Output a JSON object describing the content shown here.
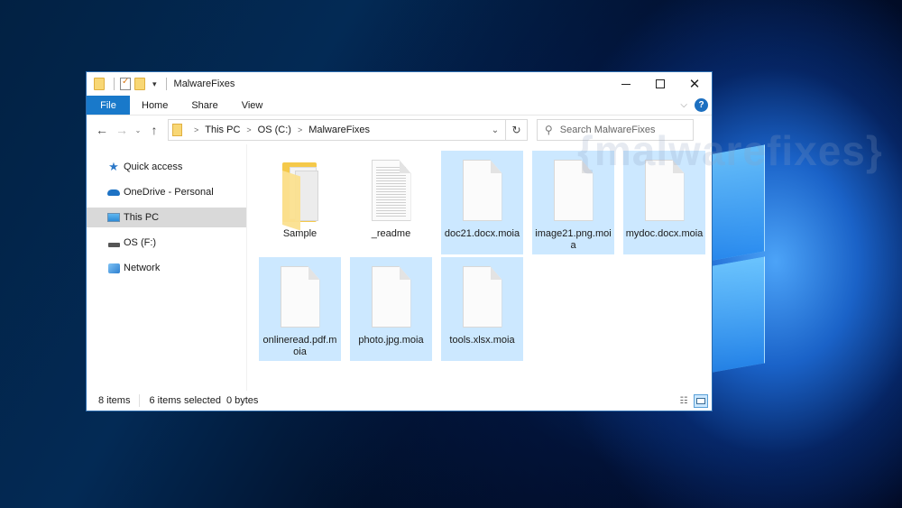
{
  "window": {
    "title": "MalwareFixes",
    "controls": {
      "minimize": "minimize",
      "maximize": "maximize",
      "close": "✕"
    }
  },
  "quick_access_toolbar": {
    "icons": [
      "folder-icon",
      "properties-icon",
      "new-folder-icon"
    ],
    "dropdown": "▾"
  },
  "ribbon": {
    "tabs": [
      {
        "label": "File",
        "active": true
      },
      {
        "label": "Home"
      },
      {
        "label": "Share"
      },
      {
        "label": "View"
      }
    ],
    "expand_chevron": "⌵",
    "help": "?"
  },
  "navigation": {
    "back": "←",
    "forward": "→",
    "recent": "⌄",
    "up": "↑",
    "breadcrumb": [
      "This PC",
      "OS (C:)",
      "MalwareFixes"
    ],
    "breadcrumb_separator": ">",
    "address_dropdown": "⌄",
    "refresh": "↻",
    "search_placeholder": "Search MalwareFixes",
    "search_value": ""
  },
  "sidebar": {
    "items": [
      {
        "label": "Quick access",
        "icon": "star-icon"
      },
      {
        "label": "OneDrive - Personal",
        "icon": "cloud-icon"
      },
      {
        "label": "This PC",
        "icon": "computer-icon",
        "selected": true
      },
      {
        "label": "OS (F:)",
        "icon": "drive-icon"
      },
      {
        "label": "Network",
        "icon": "network-icon"
      }
    ]
  },
  "files": [
    {
      "name": "Sample",
      "type": "folder",
      "selected": false
    },
    {
      "name": "_readme",
      "type": "text",
      "selected": false
    },
    {
      "name": "doc21.docx.moia",
      "type": "blank",
      "selected": true
    },
    {
      "name": "image21.png.moia",
      "type": "blank",
      "selected": true
    },
    {
      "name": "mydoc.docx.moia",
      "type": "blank",
      "selected": true
    },
    {
      "name": "onlineread.pdf.moia",
      "type": "blank",
      "selected": true
    },
    {
      "name": "photo.jpg.moia",
      "type": "blank",
      "selected": true
    },
    {
      "name": "tools.xlsx.moia",
      "type": "blank",
      "selected": true
    }
  ],
  "status": {
    "item_count": "8 items",
    "selected": "6 items selected",
    "size": "0 bytes",
    "views": [
      "details-view",
      "large-icons-view"
    ],
    "active_view": "large-icons-view"
  },
  "watermark": "{malwarefixes}",
  "colors": {
    "accent": "#1979ca",
    "selection": "#cce8ff",
    "sidebar_selected": "#d9d9d9"
  }
}
